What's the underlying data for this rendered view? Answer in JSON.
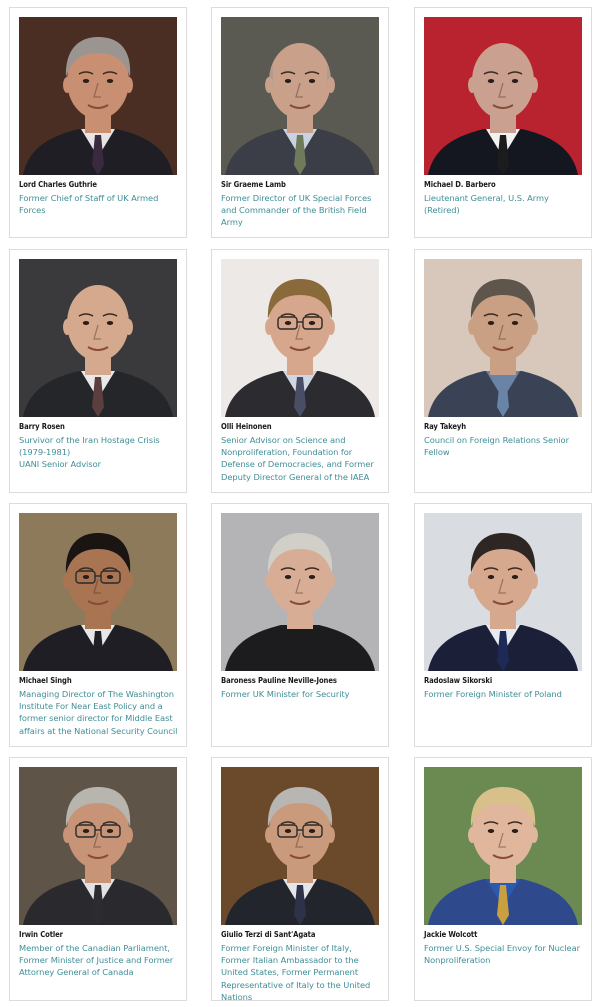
{
  "people": [
    {
      "name": "Lord Charles Guthrie",
      "role": [
        "Former Chief of Staff of UK Armed Forces"
      ],
      "portrait_bg": "#4a2e24",
      "skin": "#c98f72",
      "hair": "#9a9590",
      "suit": "#1e1e24",
      "shirt": "#e8e4e4",
      "tie": "#3a2a40",
      "glasses": false,
      "bald": false
    },
    {
      "name": "Sir Graeme Lamb",
      "role": [
        "Former Director of UK Special Forces and Commander of the British Field Army"
      ],
      "portrait_bg": "#5b5a52",
      "skin": "#c9a08a",
      "hair": "#a29a92",
      "suit": "#3b3e46",
      "shirt": "#c8d2e0",
      "tie": "#6e7a5a",
      "glasses": false,
      "bald": true
    },
    {
      "name": "Michael D. Barbero",
      "role": [
        "Lieutenant General, U.S. Army (Retired)"
      ],
      "portrait_bg": "#b8232f",
      "skin": "#caa190",
      "hair": "#caa190",
      "suit": "#14171f",
      "shirt": "#f2f2f2",
      "tie": "#1c1c1c",
      "glasses": false,
      "bald": true
    },
    {
      "name": "Barry Rosen",
      "role": [
        "Survivor of the Iran Hostage Crisis (1979-1981)",
        "UANI Senior Advisor"
      ],
      "portrait_bg": "#3a3a3c",
      "skin": "#d4a98e",
      "hair": "#d4a98e",
      "suit": "#25262a",
      "shirt": "#e9e9ea",
      "tie": "#5b3f3f",
      "glasses": false,
      "bald": true
    },
    {
      "name": "Olli Heinonen",
      "role": [
        "Senior Advisor on Science and Nonproliferation, Foundation for Defense of Democracies, and Former Deputy Director General of the IAEA"
      ],
      "portrait_bg": "#ede9e6",
      "skin": "#d6a78c",
      "hair": "#8a6a3a",
      "suit": "#2b2b30",
      "shirt": "#cfd6e4",
      "tie": "#4a4d66",
      "glasses": true,
      "bald": false
    },
    {
      "name": "Ray Takeyh",
      "role": [
        "Council on Foreign Relations Senior Fellow"
      ],
      "portrait_bg": "#d8c8bc",
      "skin": "#caa084",
      "hair": "#5e554c",
      "suit": "#3a4256",
      "shirt": "#6a84a8",
      "tie": "#6a84a8",
      "glasses": false,
      "bald": false
    },
    {
      "name": "Michael Singh",
      "role": [
        "Managing Director of The Washington Institute For Near East Policy and a former senior director for Middle East affairs at the National Security Council"
      ],
      "portrait_bg": "#8c7a5a",
      "skin": "#a87452",
      "hair": "#1a1512",
      "suit": "#1e1e24",
      "shirt": "#e6e6e8",
      "tie": "#1e1e24",
      "glasses": true,
      "bald": false
    },
    {
      "name": "Baroness Pauline Neville-Jones",
      "role": [
        "Former UK Minister for Security"
      ],
      "portrait_bg": "#b4b4b6",
      "skin": "#d8ad96",
      "hair": "#d2cfc8",
      "suit": "#1c1c1e",
      "shirt": "#1c1c1e",
      "tie": "#1c1c1e",
      "glasses": false,
      "bald": false
    },
    {
      "name": "Radoslaw Sikorski",
      "role": [
        "Former Foreign Minister of Poland"
      ],
      "portrait_bg": "#d9dde2",
      "skin": "#d6a88e",
      "hair": "#2e2622",
      "suit": "#1b2038",
      "shirt": "#e6ebf2",
      "tie": "#1c2a55",
      "glasses": false,
      "bald": false
    },
    {
      "name": "Irwin Cotler",
      "role": [
        "Member of the Canadian Parliament, Former Minister of Justice and Former Attorney General of Canada"
      ],
      "portrait_bg": "#5e5448",
      "skin": "#c89478",
      "hair": "#b8b4ae",
      "suit": "#2a2a2e",
      "shirt": "#e2e2e4",
      "tie": "#2b2b30",
      "glasses": true,
      "bald": false
    },
    {
      "name": "Giulio Terzi di Sant'Agata",
      "role": [
        "Former Foreign Minister of Italy, Former Italian Ambassador to the United States, Former Permanent Representative of Italy to the United Nations"
      ],
      "portrait_bg": "#6b4a2c",
      "skin": "#c99a7c",
      "hair": "#b8b6b2",
      "suit": "#23252c",
      "shirt": "#e4e6ea",
      "tie": "#2e3248",
      "glasses": true,
      "bald": false
    },
    {
      "name": "Jackie Wolcott",
      "role": [
        "Former U.S. Special Envoy for Nuclear Nonproliferation"
      ],
      "portrait_bg": "#6b8a52",
      "skin": "#e0b69c",
      "hair": "#d8c08a",
      "suit": "#2e4a8c",
      "shirt": "#2a5ab0",
      "tie": "#c9a040",
      "glasses": false,
      "bald": false
    }
  ]
}
